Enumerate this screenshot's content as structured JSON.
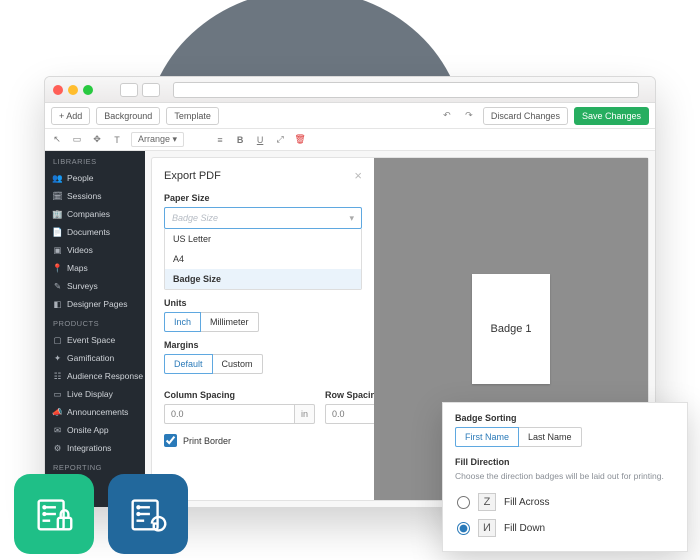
{
  "appbar": {
    "add": "+ Add",
    "background": "Background",
    "template": "Template",
    "discard": "Discard Changes",
    "save": "Save Changes"
  },
  "toolbar": {
    "arrange": "Arrange"
  },
  "sidebar": {
    "section_libraries": "LIBRARIES",
    "libraries": [
      {
        "label": "People",
        "icon": "👥"
      },
      {
        "label": "Sessions",
        "icon": "🗓"
      },
      {
        "label": "Companies",
        "icon": "🏢"
      },
      {
        "label": "Documents",
        "icon": "📄"
      },
      {
        "label": "Videos",
        "icon": "▣"
      },
      {
        "label": "Maps",
        "icon": "📍"
      },
      {
        "label": "Surveys",
        "icon": "✎"
      },
      {
        "label": "Designer Pages",
        "icon": "◧"
      }
    ],
    "section_products": "PRODUCTS",
    "products": [
      {
        "label": "Event Space",
        "icon": "▢"
      },
      {
        "label": "Gamification",
        "icon": "✦"
      },
      {
        "label": "Audience Response",
        "icon": "☷"
      },
      {
        "label": "Live Display",
        "icon": "▭"
      },
      {
        "label": "Announcements",
        "icon": "📣"
      },
      {
        "label": "Onsite App",
        "icon": "✉"
      },
      {
        "label": "Integrations",
        "icon": "⚙"
      }
    ],
    "section_reporting": "REPORTING"
  },
  "modal": {
    "title": "Export PDF",
    "paper_size_label": "Paper Size",
    "paper_size_placeholder": "Badge Size",
    "paper_options": [
      "US Letter",
      "A4",
      "Badge Size"
    ],
    "paper_selected_index": 2,
    "units_label": "Units",
    "units": [
      "Inch",
      "Millimeter"
    ],
    "units_active_index": 0,
    "margins_label": "Margins",
    "margins": [
      "Default",
      "Custom"
    ],
    "margins_active_index": 0,
    "col_spacing_label": "Column Spacing",
    "row_spacing_label": "Row Spacing",
    "spacing_placeholder": "0.0",
    "spacing_unit": "in",
    "print_border_label": "Print Border",
    "print_border_checked": true,
    "preview_badge_label": "Badge 1"
  },
  "popover": {
    "sorting_label": "Badge Sorting",
    "sorting_options": [
      "First Name",
      "Last Name"
    ],
    "sorting_active_index": 0,
    "fill_dir_label": "Fill Direction",
    "fill_dir_desc": "Choose the direction badges will be laid out for printing.",
    "fill_across": "Fill Across",
    "fill_down": "Fill Down",
    "fill_selected": "down"
  }
}
